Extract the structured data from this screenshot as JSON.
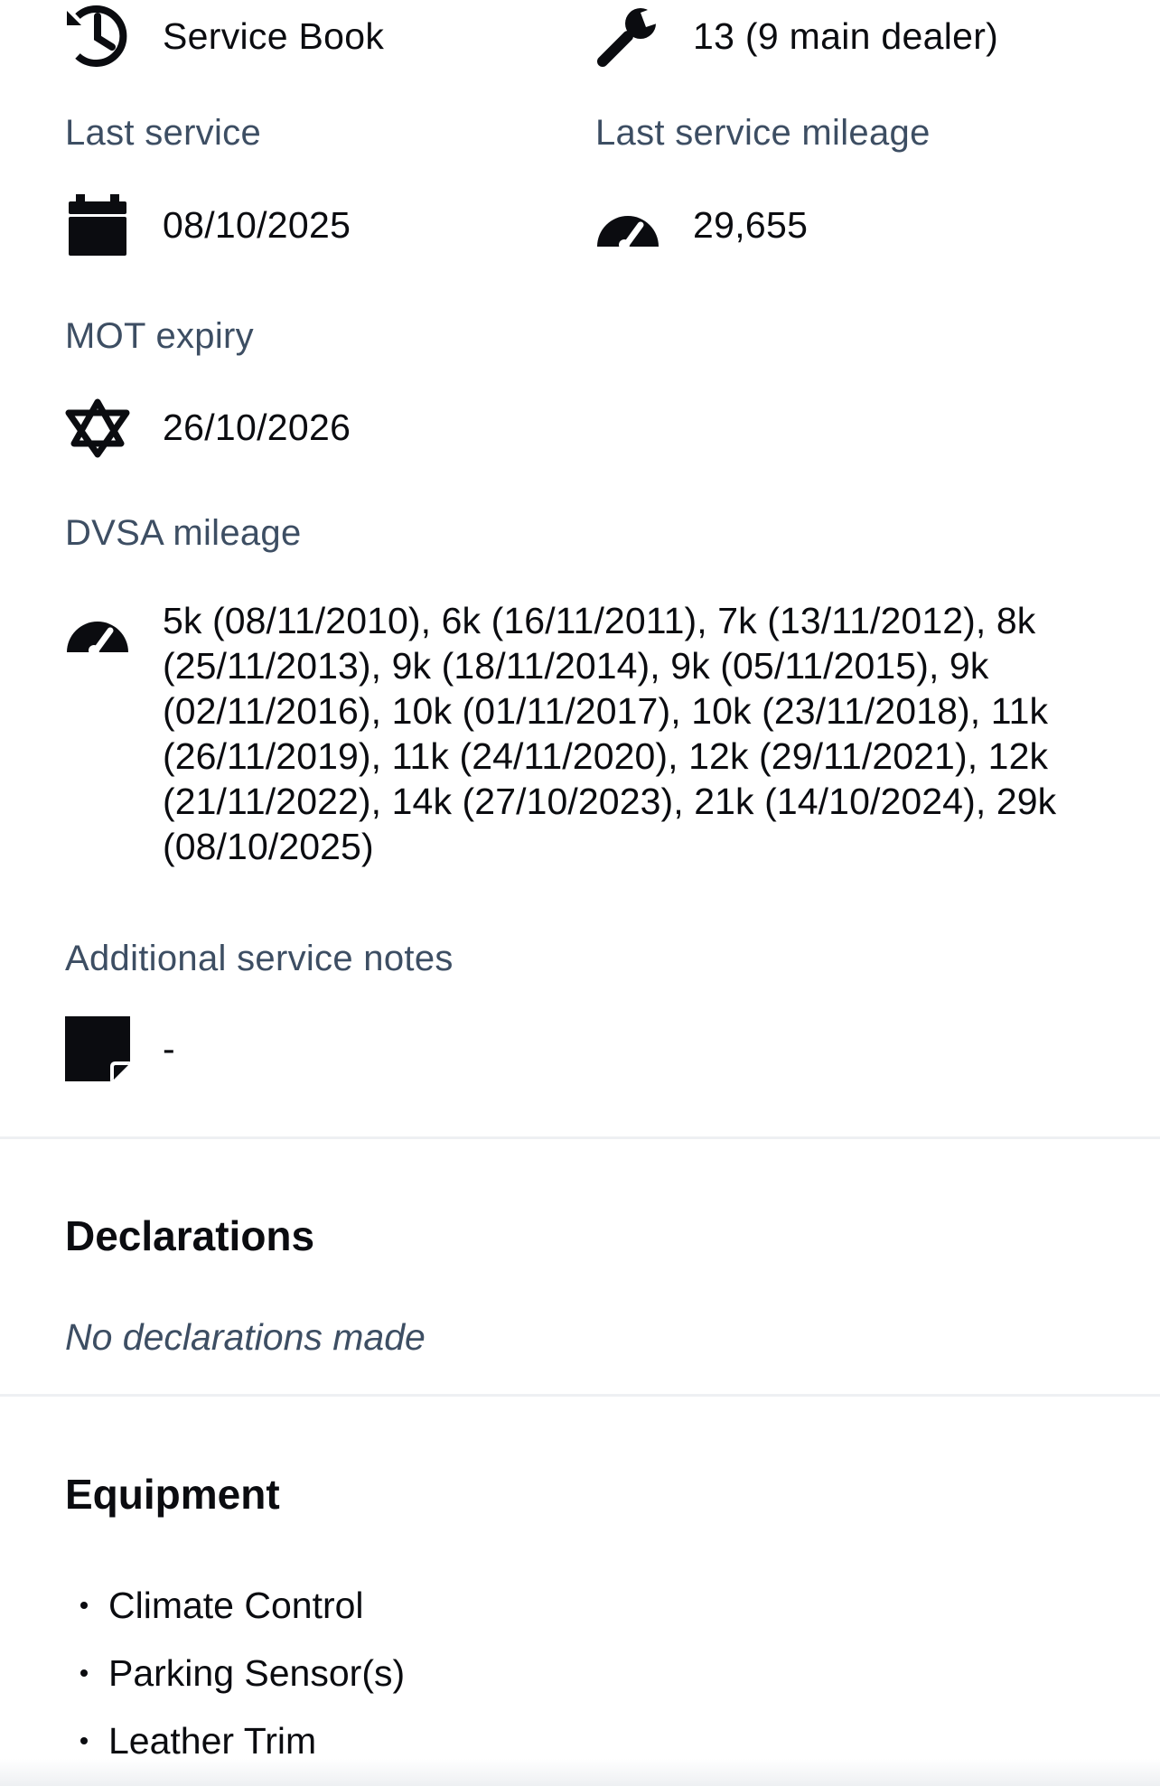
{
  "service": {
    "history": {
      "icon": "history-icon",
      "value": "Service Book"
    },
    "services_count": {
      "icon": "wrench-icon",
      "value": "13 (9 main dealer)"
    },
    "last_service": {
      "label": "Last service",
      "icon": "calendar-icon",
      "value": "08/10/2025"
    },
    "last_service_mileage": {
      "label": "Last service mileage",
      "icon": "speedometer-icon",
      "value": "29,655"
    },
    "mot_expiry": {
      "label": "MOT expiry",
      "icon": "mot-triangles-icon",
      "value": "26/10/2026"
    },
    "dvsa_mileage": {
      "label": "DVSA mileage",
      "icon": "speedometer-icon",
      "value": "5k (08/11/2010), 6k (16/11/2011), 7k (13/11/2012), 8k (25/11/2013), 9k (18/11/2014), 9k (05/11/2015), 9k (02/11/2016), 10k (01/11/2017), 10k (23/11/2018), 11k (26/11/2019), 11k (24/11/2020), 12k (29/11/2021), 12k (21/11/2022), 14k (27/10/2023), 21k (14/10/2024), 29k (08/10/2025)"
    },
    "additional_notes": {
      "label": "Additional service notes",
      "icon": "note-icon",
      "value": "-"
    }
  },
  "declarations": {
    "title": "Declarations",
    "empty_text": "No declarations made"
  },
  "equipment": {
    "title": "Equipment",
    "items": [
      "Climate Control",
      "Parking Sensor(s)",
      "Leather Trim"
    ]
  },
  "colors": {
    "text": "#0b0c10",
    "label": "#3d4e63",
    "divider": "#eef0f3"
  }
}
